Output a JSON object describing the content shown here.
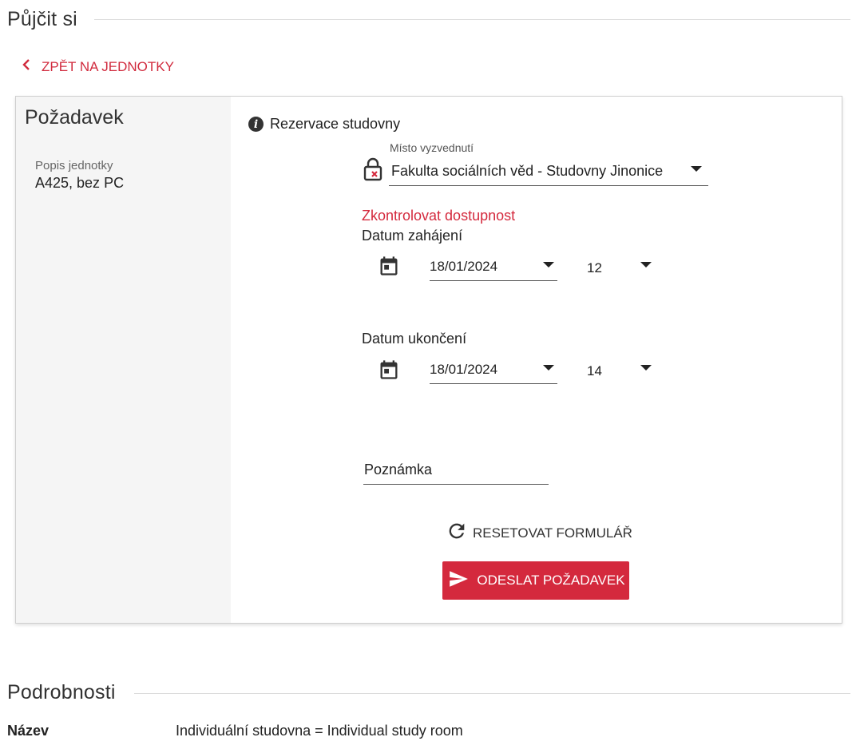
{
  "page": {
    "title": "Půjčit si",
    "back_label": "ZPĚT NA JEDNOTKY"
  },
  "request": {
    "title": "Požadavek",
    "unit_desc_label": "Popis jednotky",
    "unit_desc_value": "A425, bez PC",
    "info_text": "Rezervace studovny",
    "pickup": {
      "label": "Místo vyzvednutí",
      "value": "Fakulta sociálních věd - Studovny Jinonice"
    },
    "check_availability": "Zkontrolovat dostupnost",
    "start": {
      "label": "Datum zahájení",
      "date": "18/01/2024",
      "hour": "12"
    },
    "end": {
      "label": "Datum ukončení",
      "date": "18/01/2024",
      "hour": "14"
    },
    "note_label": "Poznámka",
    "reset_label": "RESETOVAT FORMULÁŘ",
    "submit_label": "ODESLAT POŽADAVEK"
  },
  "details": {
    "title": "Podrobnosti",
    "rows": [
      {
        "key": "Název",
        "value": "Individuální studovna = Individual study room"
      }
    ]
  },
  "colors": {
    "accent": "#d4293d",
    "link": "#d12b3e"
  }
}
